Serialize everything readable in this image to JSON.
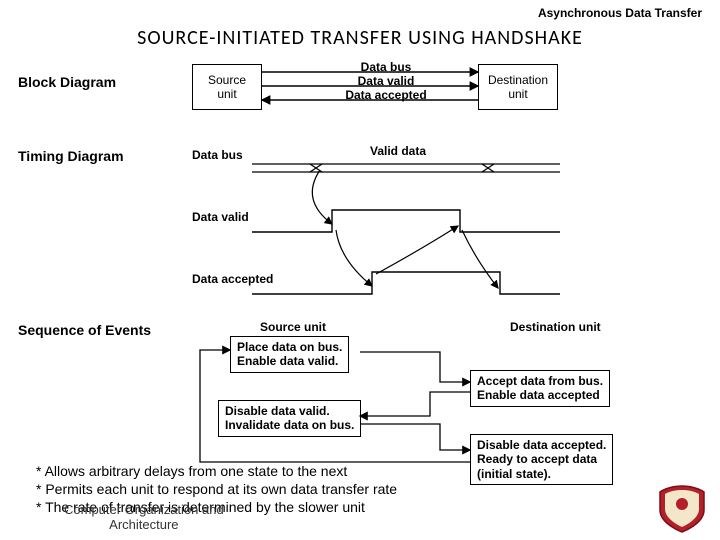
{
  "topic": "Asynchronous Data Transfer",
  "title": "SOURCE-INITIATED  TRANSFER  USING  HANDSHAKE",
  "sections": {
    "block": "Block Diagram",
    "timing": "Timing Diagram",
    "sequence": "Sequence of Events"
  },
  "block": {
    "source": "Source\nunit",
    "dest": "Destination\nunit",
    "signals": {
      "data_bus": "Data bus",
      "data_valid": "Data valid",
      "data_accepted": "Data accepted"
    }
  },
  "timing": {
    "data_bus": "Data bus",
    "valid_data": "Valid data",
    "data_valid": "Data valid",
    "data_accepted": "Data accepted"
  },
  "sequence": {
    "source_head": "Source unit",
    "dest_head": "Destination unit",
    "step1": "Place data on bus.\nEnable data valid.",
    "step2": "Accept data from bus.\nEnable data accepted",
    "step3": "Disable data valid.\nInvalidate data on bus.",
    "step4": "Disable data accepted.\nReady to accept data\n(initial state)."
  },
  "bullets": {
    "b1": "* Allows arbitrary delays from one state to the next",
    "b2": "* Permits each unit to respond at its own data transfer rate",
    "b3": "* The rate of transfer is determined by the slower unit"
  },
  "footer": "Computer Organization and\nArchitecture"
}
